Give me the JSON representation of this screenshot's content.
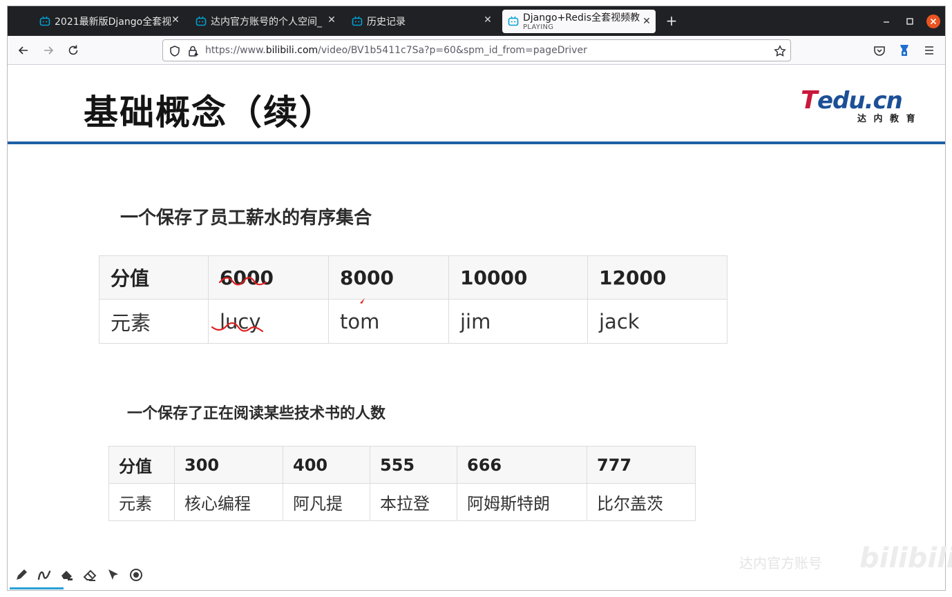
{
  "browser": {
    "tabs": [
      {
        "title": "2021最新版Django全套视"
      },
      {
        "title": "达内官方账号的个人空间_"
      },
      {
        "title": "历史记录"
      },
      {
        "title": "Django+Redis全套视频教",
        "subtitle": "PLAYING",
        "active": true
      }
    ],
    "new_tab_label": "+",
    "url_prefix": "https://www.",
    "url_host": "bilibili.com",
    "url_path": "/video/BV1b5411c7Sa?p=60&spm_id_from=pageDriver",
    "icons": [
      "back-icon",
      "forward-icon",
      "reload-icon",
      "shield-icon",
      "lock-icon",
      "bookmark-star-icon",
      "pocket-icon",
      "extension-icon",
      "menu-icon"
    ],
    "colors": {
      "chrome": "#202124",
      "toolbar": "#f9f9fb",
      "close_accent": "#e95420",
      "tab_icon": "#00a1d6"
    }
  },
  "slide": {
    "title": "基础概念（续）",
    "logo": {
      "brand": "Tedu.cn",
      "tagline": "达 内 教 育"
    },
    "accent_color": "#1f5fa6",
    "section1": {
      "heading": "一个保存了员工薪水的有序集合",
      "header": [
        "分值",
        "6000",
        "8000",
        "10000",
        "12000"
      ],
      "row": [
        "元素",
        "lucy",
        "tom",
        "jim",
        "jack"
      ]
    },
    "section2": {
      "heading": "一个保存了正在阅读某些技术书的人数",
      "header": [
        "分值",
        "300",
        "400",
        "555",
        "666",
        "777"
      ],
      "row": [
        "元素",
        "核心编程",
        "阿凡提",
        "本拉登",
        "阿姆斯特朗",
        "比尔盖茨"
      ]
    },
    "annotation_color": "#e02020"
  },
  "player_tools": [
    "pen-icon",
    "curve-icon",
    "highlighter-icon",
    "eraser-icon",
    "pointer-icon",
    "record-icon"
  ],
  "watermark": {
    "text": "达内官方账号",
    "brand": "bilibili"
  }
}
